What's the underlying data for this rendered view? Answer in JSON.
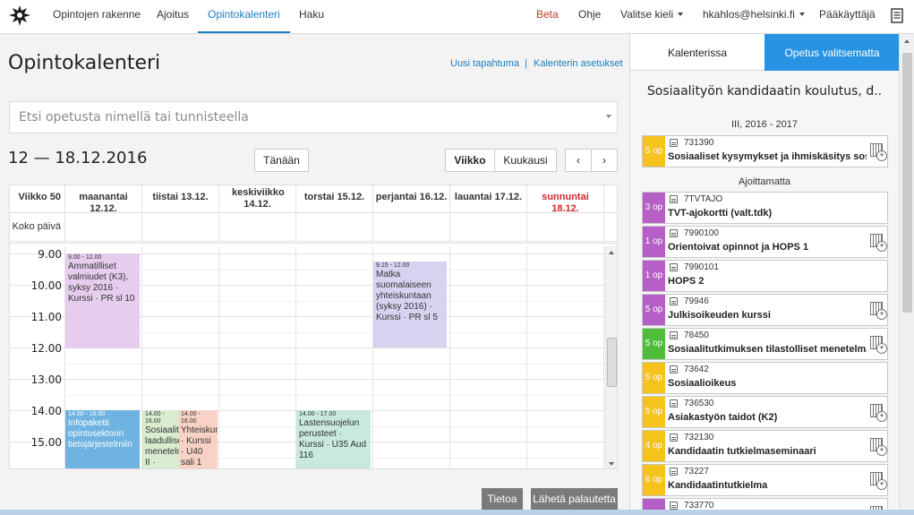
{
  "nav": {
    "items": [
      "Opintojen rakenne",
      "Ajoitus",
      "Opintokalenteri",
      "Haku"
    ],
    "beta": "Beta",
    "help": "Ohje",
    "language": "Valitse kieli",
    "user": "hkahlos@helsinki.fi",
    "admin": "Pääkäyttäjä"
  },
  "page": {
    "title": "Opintokalenteri",
    "new_event": "Uusi tapahtuma",
    "separator": "|",
    "settings": "Kalenterin asetukset"
  },
  "search": {
    "placeholder": "Etsi opetusta nimellä tai tunnisteella"
  },
  "toolbar": {
    "date_range": "12 — 18.12.2016",
    "today": "Tänään",
    "week": "Viikko",
    "month": "Kuukausi",
    "prev": "‹",
    "next": "›"
  },
  "calendar": {
    "week_label": "Viikko 50",
    "allday_label": "Koko päivä",
    "days": [
      "maanantai 12.12.",
      "tiistai 13.12.",
      "keskiviikko 14.12.",
      "torstai 15.12.",
      "perjantai 16.12.",
      "lauantai 17.12.",
      "sunnuntai 18.12."
    ],
    "hours": [
      "9.00",
      "10.00",
      "11.00",
      "12.00",
      "13.00",
      "14.00",
      "15.00"
    ],
    "events": [
      {
        "time": "9.00 - 12.00",
        "title": "Ammatilliset valmiudet (K3), syksy 2016 · Kurssi · PR sl 10",
        "color": "#e6cdee"
      },
      {
        "time": "9.15 - 12.00",
        "title": "Matka suomalaiseen yhteiskuntaan (syksy 2016) · Kurssi · PR sl 5",
        "color": "#d5d3f0"
      },
      {
        "time": "14.00 - 16.00",
        "title": "Infopaketti opintosektorin tietojärjestelmiin",
        "color": "#6fb3e0"
      },
      {
        "time": "14.00 - 16.00",
        "title": "Sosiaalityön laadulliset menetelmät II · Kurssi · U40 sali",
        "color": "#d8ecd0"
      },
      {
        "time": "14.00 - 16.00",
        "title": "Yhteiskunta · Kurssi · U40 sali 1",
        "color": "#f8d2c4"
      },
      {
        "time": "14.00 - 17.00",
        "title": "Lastensuojelun perusteet · Kurssi · U35 Aud 116",
        "color": "#c8e8e0"
      }
    ]
  },
  "footer": {
    "info": "Tietoa",
    "feedback": "Lähetä palautetta"
  },
  "right_panel": {
    "tabs": [
      "Kalenterissa",
      "Opetus valitsematta"
    ],
    "program": "Sosiaalityön kandidaatin koulutus, d..",
    "period": "III, 2016 - 2017",
    "unscheduled": "Ajoittamatta",
    "courses": [
      {
        "ects": "5 op",
        "code": "731390",
        "name": "Sosiaaliset kysymykset ja ihmiskäsitys sosi..",
        "color": "#f6c21c",
        "calendar": true
      },
      {
        "ects": "3 op",
        "code": "7TVTAJO",
        "name": "TVT-ajokortti (valt.tdk)",
        "color": "#b65fc6",
        "calendar": false
      },
      {
        "ects": "1 op",
        "code": "7990100",
        "name": "Orientoivat opinnot ja HOPS 1",
        "color": "#b65fc6",
        "calendar": true
      },
      {
        "ects": "1 op",
        "code": "7990101",
        "name": "HOPS 2",
        "color": "#b65fc6",
        "calendar": false
      },
      {
        "ects": "5 op",
        "code": "79946",
        "name": "Julkisoikeuden kurssi",
        "color": "#b65fc6",
        "calendar": true
      },
      {
        "ects": "5 op",
        "code": "78450",
        "name": "Sosiaalitutkimuksen tilastolliset menetelmät",
        "color": "#4dbd3a",
        "calendar": true
      },
      {
        "ects": "5 op",
        "code": "73642",
        "name": "Sosiaalioikeus",
        "color": "#f6c21c",
        "calendar": false
      },
      {
        "ects": "5 op",
        "code": "736530",
        "name": "Asiakastyön taidot (K2)",
        "color": "#f6c21c",
        "calendar": true
      },
      {
        "ects": "4 op",
        "code": "732130",
        "name": "Kandidaatin tutkielmaseminaari",
        "color": "#f6c21c",
        "calendar": true
      },
      {
        "ects": "6 op",
        "code": "73227",
        "name": "Kandidaatintutkielma",
        "color": "#f6c21c",
        "calendar": true
      },
      {
        "ects": "",
        "code": "733770",
        "name": "",
        "color": "#b65fc6",
        "calendar": true
      }
    ]
  },
  "icons": {
    "logo": "helsinki-university-logo-icon",
    "print": "print-icon",
    "document": "document-icon",
    "add_to_calendar": "add-to-calendar-icon"
  }
}
